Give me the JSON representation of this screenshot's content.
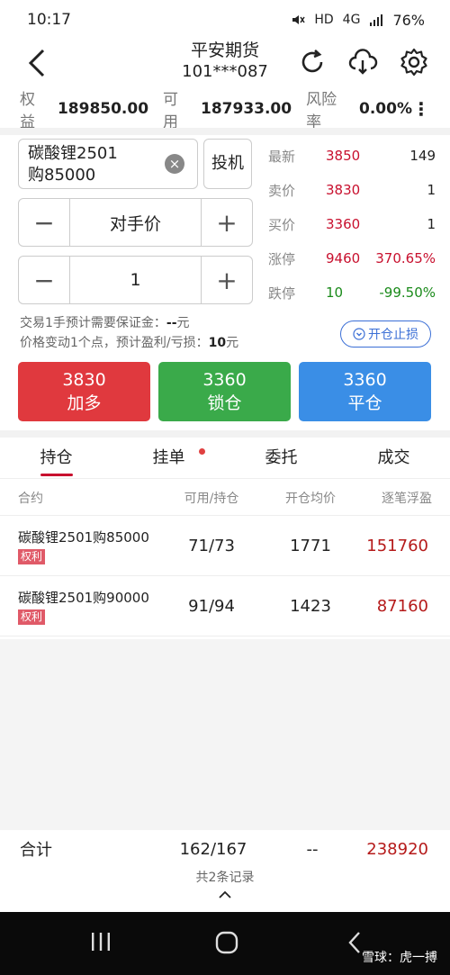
{
  "status": {
    "time": "10:17",
    "net": "HD",
    "signal": "4G",
    "battery": "76%"
  },
  "header": {
    "title": "平安期货",
    "account": "101***087"
  },
  "account_bar": {
    "equity_label": "权益",
    "equity_value": "189850.00",
    "avail_label": "可用",
    "avail_value": "187933.00",
    "risk_label": "风险率",
    "risk_value": "0.00%",
    "more": "⋮"
  },
  "order": {
    "contract_line1": "碳酸锂2501",
    "contract_line2": "购85000",
    "clear": "×",
    "spec": "投机",
    "price_label": "对手价",
    "qty": "1",
    "minus": "−",
    "plus": "+"
  },
  "quotes": [
    {
      "label": "最新",
      "price": "3850",
      "vol": "149",
      "price_color": "red",
      "vol_color": ""
    },
    {
      "label": "卖价",
      "price": "3830",
      "vol": "1",
      "price_color": "red",
      "vol_color": ""
    },
    {
      "label": "买价",
      "price": "3360",
      "vol": "1",
      "price_color": "red",
      "vol_color": ""
    },
    {
      "label": "涨停",
      "price": "9460",
      "vol": "370.65%",
      "price_color": "red",
      "vol_color": "red"
    },
    {
      "label": "跌停",
      "price": "10",
      "vol": "-99.50%",
      "price_color": "green",
      "vol_color": "green"
    }
  ],
  "info": {
    "margin_text": "交易1手预计需要保证金：",
    "margin_value": "--",
    "margin_unit": "元",
    "tick_text": "价格变动1个点，预计盈利/亏损：",
    "tick_value": "10",
    "tick_unit": "元",
    "sl_button": "开仓止损",
    "sl_icon": "chevron-down-icon"
  },
  "actions": [
    {
      "price": "3830",
      "label": "加多",
      "color": "#e0393e"
    },
    {
      "price": "3360",
      "label": "锁仓",
      "color": "#3aaa4a"
    },
    {
      "price": "3360",
      "label": "平仓",
      "color": "#3a8ee6"
    }
  ],
  "tabs": [
    "持仓",
    "挂单",
    "委托",
    "成交"
  ],
  "table": {
    "headers": [
      "合约",
      "可用/持仓",
      "开仓均价",
      "逐笔浮盈"
    ],
    "rows": [
      {
        "name": "碳酸锂2501购85000",
        "tag": "权利",
        "avail": "71/73",
        "avg": "1771",
        "pl": "151760"
      },
      {
        "name": "碳酸锂2501购90000",
        "tag": "权利",
        "avail": "91/94",
        "avg": "1423",
        "pl": "87160"
      }
    ]
  },
  "total": {
    "label": "合计",
    "avail": "162/167",
    "avg": "--",
    "pl": "238920",
    "count": "共2条记录"
  },
  "watermark": "雪球：虎一搏"
}
